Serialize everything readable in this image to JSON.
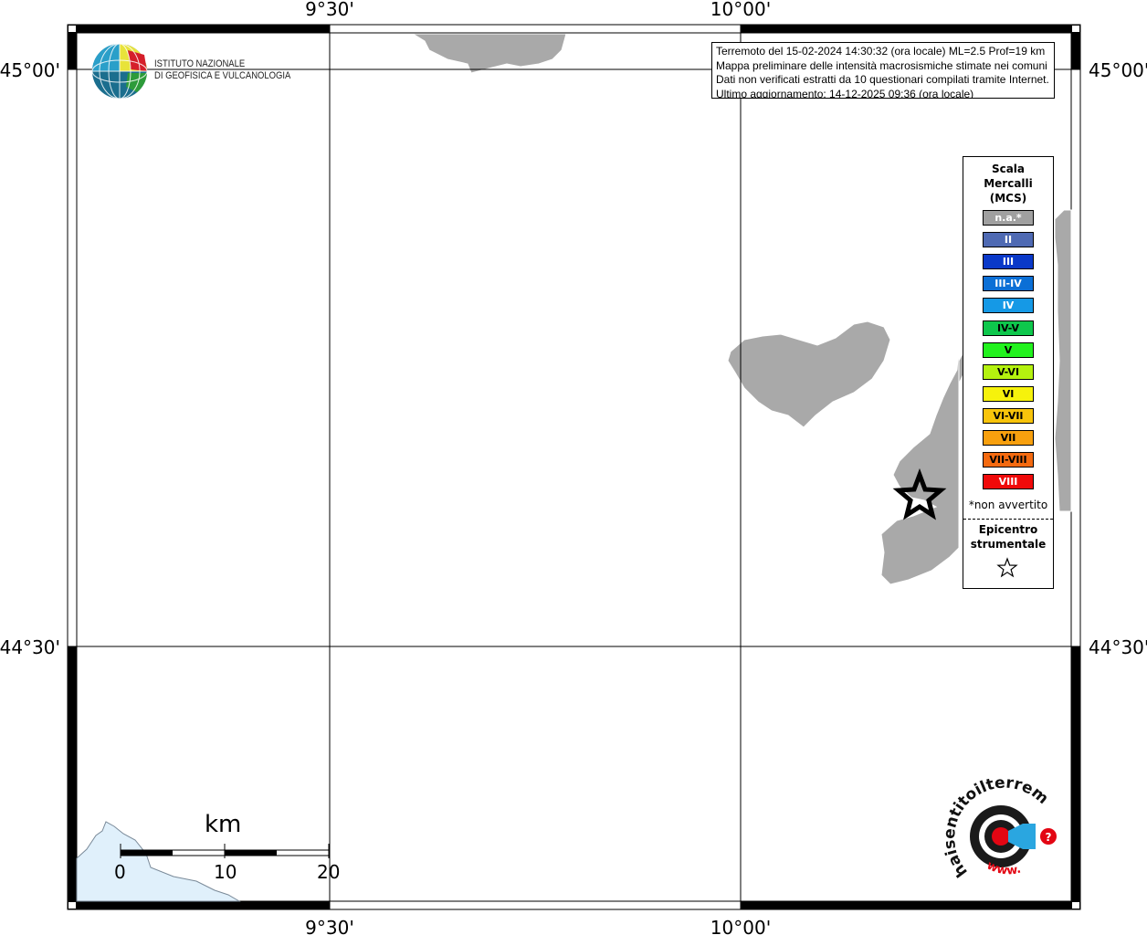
{
  "map": {
    "lon_labels": [
      "9°30'",
      "10°00'"
    ],
    "lat_labels": [
      "45°00'",
      "44°30'"
    ]
  },
  "institute": {
    "line1": "ISTITUTO NAZIONALE",
    "line2": "DI GEOFISICA E VULCANOLOGIA"
  },
  "info": {
    "line1": "Terremoto del 15-02-2024 14:30:32 (ora locale) ML=2.5 Prof=19 km",
    "line2": "Mappa preliminare delle intensità macrosismiche stimate nei comuni",
    "line3": "Dati non verificati estratti da 10 questionari compilati tramite Internet.",
    "line4": "Ultimo aggiornamento: 14-12-2025 09:36 (ora locale)"
  },
  "legend": {
    "title_line1": "Scala",
    "title_line2": "Mercalli",
    "title_line3": "(MCS)",
    "items": [
      {
        "label": "n.a.*",
        "color": "#a0a0a0",
        "text_color": "#ffffff"
      },
      {
        "label": "II",
        "color": "#4f6ab3",
        "text_color": "#ffffff"
      },
      {
        "label": "III",
        "color": "#0a39c9",
        "text_color": "#ffffff"
      },
      {
        "label": "III-IV",
        "color": "#0b6fd6",
        "text_color": "#ffffff"
      },
      {
        "label": "IV",
        "color": "#1599e6",
        "text_color": "#ffffff"
      },
      {
        "label": "IV-V",
        "color": "#0ec74c",
        "text_color": "#000000"
      },
      {
        "label": "V",
        "color": "#22f21e",
        "text_color": "#000000"
      },
      {
        "label": "V-VI",
        "color": "#b4f20f",
        "text_color": "#000000"
      },
      {
        "label": "VI",
        "color": "#f6f20c",
        "text_color": "#000000"
      },
      {
        "label": "VI-VII",
        "color": "#f8c40b",
        "text_color": "#000000"
      },
      {
        "label": "VII",
        "color": "#f8a00e",
        "text_color": "#000000"
      },
      {
        "label": "VII-VIII",
        "color": "#f46a10",
        "text_color": "#000000"
      },
      {
        "label": "VIII",
        "color": "#f00a0a",
        "text_color": "#ffffff"
      }
    ],
    "na_note": "*non avvertito",
    "epicenter_line1": "Epicentro",
    "epicenter_line2": "strumentale"
  },
  "scale_bar": {
    "unit": "km",
    "ticks": [
      "0",
      "10",
      "20"
    ]
  },
  "colors": {
    "land": "#a9a9a9",
    "sea_inset": "#e0f0fb"
  },
  "brand": {
    "arc_text": "haisentitoilterremoto.it",
    "www_text": "www."
  }
}
